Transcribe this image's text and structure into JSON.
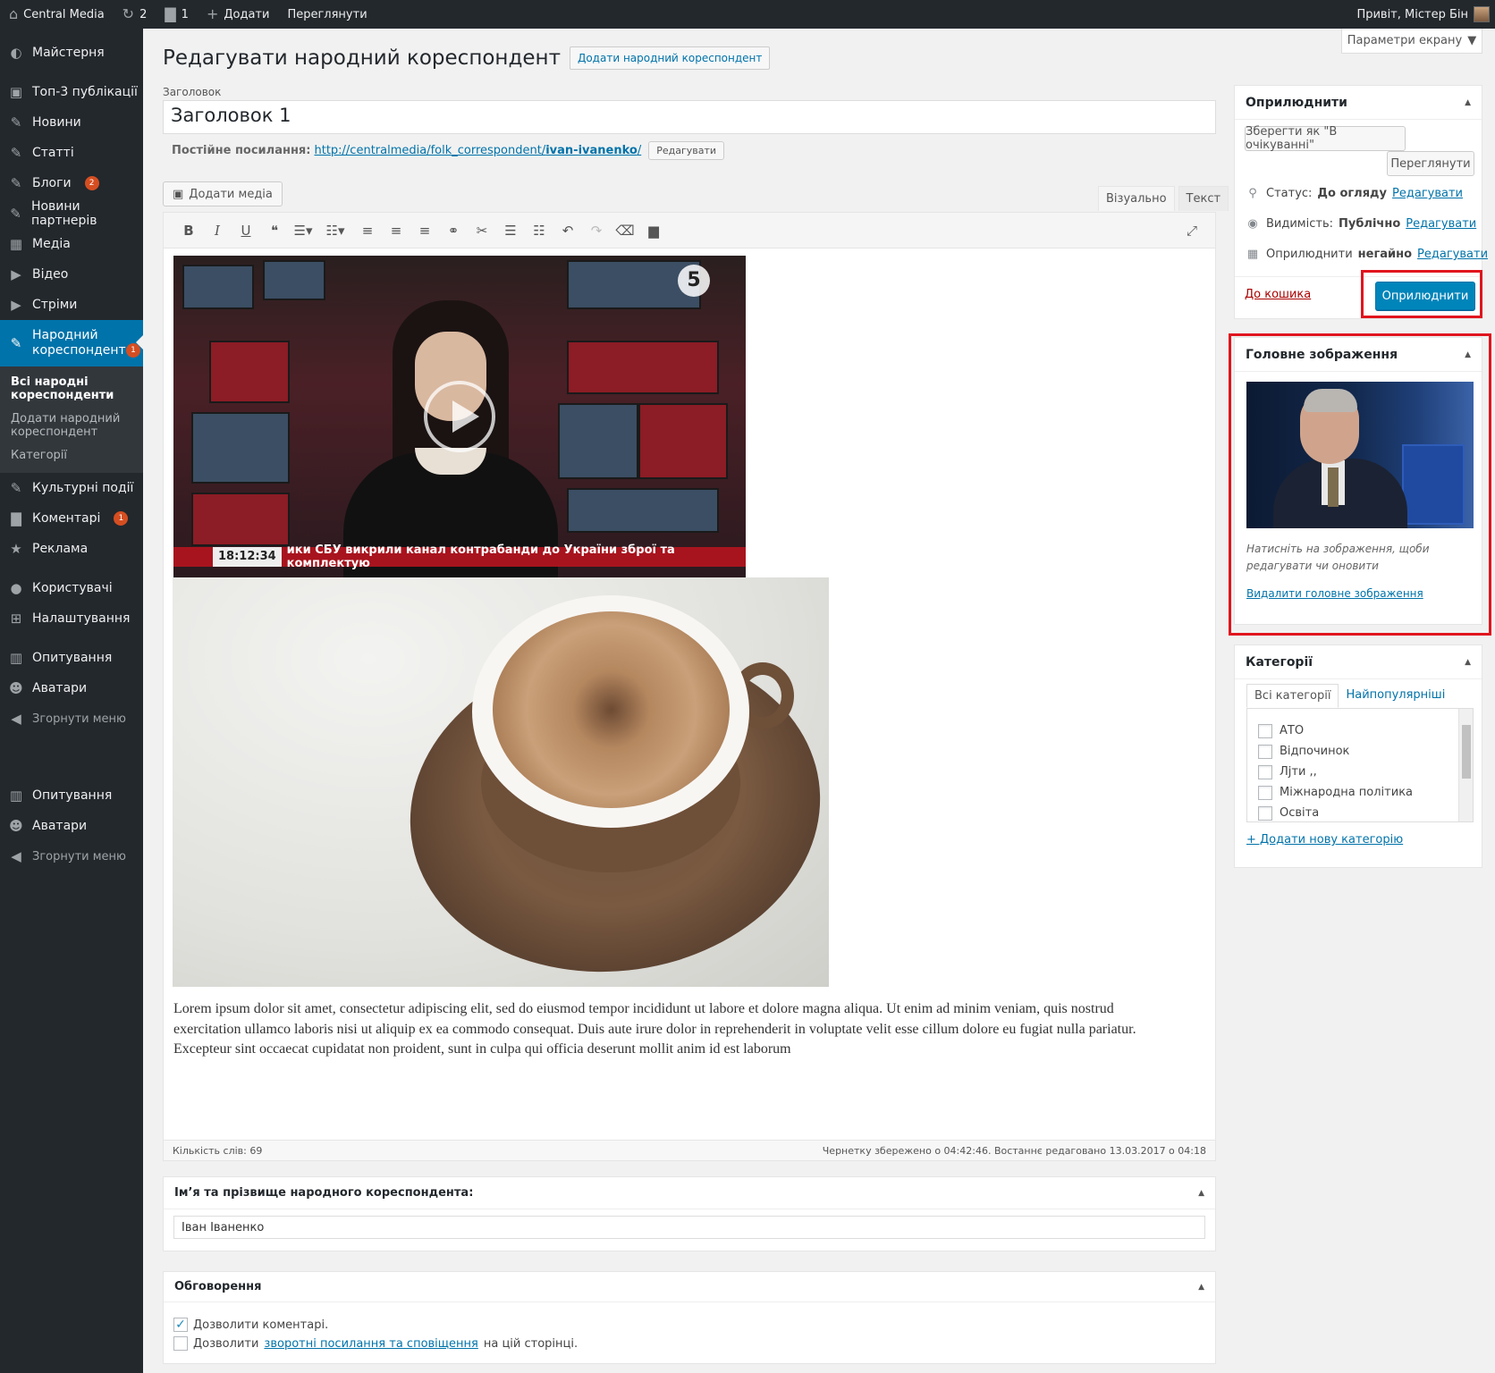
{
  "adminbar": {
    "site_name": "Central Media",
    "updates_count": "2",
    "comments_count": "1",
    "add_label": "Додати",
    "view_label": "Переглянути",
    "greeting": "Привіт, Містер Бін"
  },
  "sidebar": {
    "items": [
      {
        "label": "Майстерня",
        "icon": "dashboard-icon"
      },
      {
        "label": "Топ-3 публікації",
        "icon": "pin-icon"
      },
      {
        "label": "Новини",
        "icon": "edit-icon"
      },
      {
        "label": "Статті",
        "icon": "edit-icon"
      },
      {
        "label": "Блоги",
        "icon": "edit-icon",
        "badge": "2"
      },
      {
        "label": "Новини партнерів",
        "icon": "edit-icon"
      },
      {
        "label": "Медіа",
        "icon": "media-icon"
      },
      {
        "label": "Відео",
        "icon": "video-icon"
      },
      {
        "label": "Стріми",
        "icon": "video-icon"
      },
      {
        "label": "Народний кореспондент",
        "icon": "edit-icon",
        "badge": "1"
      }
    ],
    "submenu": [
      "Всі народні кореспонденти",
      "Додати народний кореспондент",
      "Категорії"
    ],
    "items_after": [
      {
        "label": "Культурні події",
        "icon": "edit-icon"
      },
      {
        "label": "Коментарі",
        "icon": "comment-icon",
        "badge": "1"
      },
      {
        "label": "Реклама",
        "icon": "star-icon"
      },
      {
        "label": "Користувачі",
        "icon": "users-icon"
      },
      {
        "label": "Налаштування",
        "icon": "settings-icon"
      },
      {
        "label": "Опитування",
        "icon": "poll-icon"
      },
      {
        "label": "Аватари",
        "icon": "avatar-icon"
      },
      {
        "label": "Згорнути меню",
        "icon": "collapse-icon"
      },
      {
        "label": "Опитування",
        "icon": "poll-icon"
      },
      {
        "label": "Аватари",
        "icon": "avatar-icon"
      },
      {
        "label": "Згорнути меню",
        "icon": "collapse-icon"
      }
    ]
  },
  "screen_options": "Параметри екрану",
  "page": {
    "title": "Редагувати народний кореспондент",
    "add_new": "Додати народний кореспондент",
    "title_label": "Заголовок",
    "title_value": "Заголовок 1",
    "permalink_label": "Постійне посилання:",
    "permalink_url_prefix": "http://centralmedia/folk_correspondent/",
    "permalink_slug": "ivan-ivanenko",
    "permalink_url_suffix": "/",
    "permalink_edit": "Редагувати"
  },
  "editor": {
    "add_media": "Додати медіа",
    "tab_visual": "Візуально",
    "tab_text": "Текст",
    "video_time": "18:12:34",
    "video_ticker": "ики СБУ викрили канал контрабанди до України зброї та комплектую",
    "video_channel_logo": "5",
    "body_text": "Lorem ipsum dolor sit amet, consectetur adipiscing elit, sed do eiusmod tempor incididunt ut labore et dolore magna aliqua. Ut enim ad minim veniam, quis nostrud exercitation ullamco laboris nisi ut aliquip ex ea commodo consequat. Duis aute irure dolor in reprehenderit in voluptate velit esse cillum dolore eu fugiat nulla pariatur. Excepteur sint occaecat cupidatat non proident, sunt in culpa qui officia deserunt mollit anim id est laborum",
    "word_count": "Кількість слів: 69",
    "saved_status": "Чернетку збережено о 04:42:46. Востаннє редаговано 13.03.2017 о 04:18"
  },
  "name_box": {
    "title": "Ім’я та прізвище народного кореспондента:",
    "value": "Іван Іваненко"
  },
  "discussion": {
    "title": "Обговорення",
    "allow_comments": "Дозволити коментарі.",
    "allow_pings_prefix": "Дозволити",
    "allow_pings_link": "зворотні посилання та сповіщення",
    "allow_pings_suffix": "на цій сторінці."
  },
  "publish": {
    "title": "Оприлюднити",
    "save_draft": "Зберегти як \"В очікуванні\"",
    "preview": "Переглянути",
    "status_label": "Статус:",
    "status_value": "До огляду",
    "visibility_label": "Видимість:",
    "visibility_value": "Публічно",
    "publish_label": "Оприлюднити",
    "publish_value": "негайно",
    "edit": "Редагувати",
    "trash": "До кошика",
    "publish_button": "Оприлюднити"
  },
  "featured": {
    "title": "Головне зображення",
    "hint": "Натисніть на зображення, щоби редагувати чи оновити",
    "remove": "Видалити головне зображення"
  },
  "categories": {
    "title": "Категорії",
    "tab_all": "Всі категорії",
    "tab_popular": "Найпопулярніші",
    "items": [
      "АТО",
      "Відпочинок",
      "Лjти  ,,",
      "Міжнародна політика",
      "Освіта"
    ],
    "add_new": "+ Додати нову категорію"
  },
  "colors": {
    "accent": "#0073aa",
    "sidebar_bg": "#23282d",
    "highlight": "#e0151e"
  }
}
